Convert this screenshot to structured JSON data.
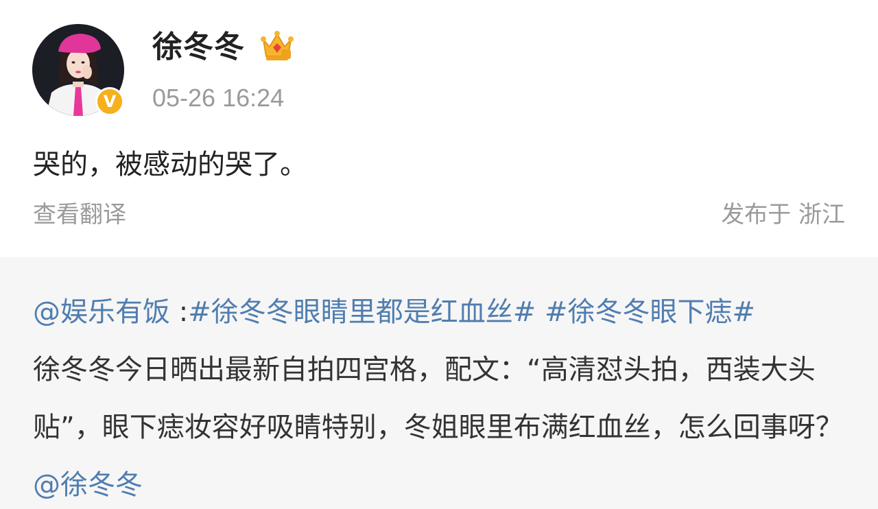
{
  "author": {
    "name": "徐冬冬",
    "avatar_icon": "avatar",
    "verified_badge": "V",
    "verified_color": "#f5b01c",
    "member_icon": "crown-icon"
  },
  "post": {
    "timestamp": "05-26 16:24",
    "text": "哭的，被感动的哭了。",
    "translate_label": "查看翻译",
    "location": "发布于 浙江"
  },
  "repost": {
    "mention": "@娱乐有饭",
    "separator": " :",
    "hashtag_1": "#徐冬冬眼睛里都是红血丝#",
    "space": " ",
    "hashtag_2": "#徐冬冬眼下痣#",
    "body": "徐冬冬今日晒出最新自拍四宫格，配文：“高清怼头拍，西装大头贴”，眼下痣妆容好吸睛特别，冬姐眼里布满红血丝，怎么回事呀？",
    "mention_2": "@徐冬冬"
  },
  "colors": {
    "link": "#507daf",
    "muted": "#9a9a9a",
    "text": "#222222",
    "repost_bg": "#f6f6f6"
  }
}
